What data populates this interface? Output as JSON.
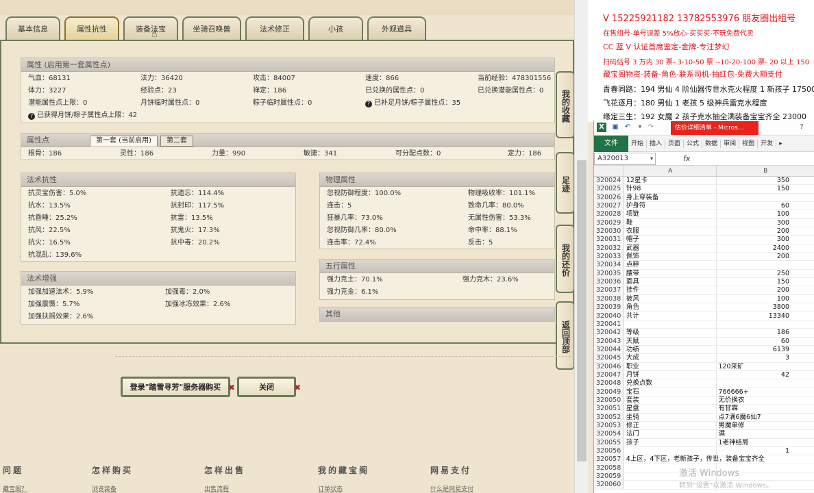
{
  "tabs": [
    {
      "label": "基本信息",
      "active": false
    },
    {
      "label": "属性抗性",
      "active": true
    },
    {
      "label": "装备法宝",
      "active": false
    },
    {
      "label": "坐骑召唤兽",
      "active": false
    },
    {
      "label": "法术修正",
      "active": false
    },
    {
      "label": "小孩",
      "active": false
    },
    {
      "label": "外观道具",
      "active": false
    }
  ],
  "attributes": {
    "header": "属性 (启用第一套属性点)",
    "items": [
      "气血：68131",
      "法力：36420",
      "攻击：84007",
      "速度：866",
      "当前经验：478301556",
      "体力：3227",
      "经验点：23",
      "禅定：186",
      "已兑换的属性点：0",
      "已兑换潜能属性点：0",
      "潜能属性点上限：0",
      "月饼临时属性点：0",
      "粽子临时属性点：0",
      "已补足月饼/粽子属性点：35"
    ],
    "note": "已获得月饼/粽子属性点上限：42"
  },
  "points": {
    "header": "属性点",
    "subtabs": [
      "第一套 (当前启用)",
      "第二套"
    ],
    "items": [
      "根骨：186",
      "灵性：186",
      "力量：990",
      "敏捷：341",
      "可分配点数：0",
      "定力：186"
    ]
  },
  "magic_resist": {
    "header": "法术抗性",
    "items": [
      "抗灵宝伤害：5.0%",
      "抗遗忘：114.4%",
      "抗水：13.5%",
      "抗封印：117.5%",
      "抗昏睡：25.2%",
      "抗雷：13.5%",
      "抗风：22.5%",
      "抗鬼火：17.3%",
      "抗火：16.5%",
      "抗中毒：20.2%",
      "抗混乱：139.6%",
      ""
    ]
  },
  "magic_boost": {
    "header": "法术增强",
    "items": [
      "加强加速法术：5.9%",
      "加强毒：2.0%",
      "加强震慑：5.7%",
      "加强冰冻效果：2.6%",
      "加强扶摇效果：2.6%",
      ""
    ]
  },
  "physical": {
    "header": "物理属性",
    "items": [
      "忽视防御程度：100.0%",
      "物理吸收率：101.1%",
      "连击：5",
      "致命几率：80.0%",
      "狂暴几率：73.0%",
      "无属性伤害：53.3%",
      "忽视防御几率：80.0%",
      "命中率：88.1%",
      "连击率：72.4%",
      "反击：5"
    ]
  },
  "five_elements": {
    "header": "五行属性",
    "items": [
      "强力克土：70.1%",
      "强力克木：23.6%",
      "强力克金：6.1%",
      ""
    ]
  },
  "other": {
    "header": "其他"
  },
  "side_buttons": [
    "我的收藏",
    "足迹",
    "我的还价",
    "返回顶部"
  ],
  "actions": {
    "buy": "登录\"踏雪寻芳\"服务器购买",
    "close": "关闭"
  },
  "footer": [
    {
      "head": "问题",
      "link": "藏宝阁？"
    },
    {
      "head": "怎样购买",
      "link": "浏览装备"
    },
    {
      "head": "怎样出售",
      "link": "出售流程"
    },
    {
      "head": "我的藏宝阁",
      "link": "订单状态"
    },
    {
      "head": "网易支付",
      "link": "什么是网易支付"
    }
  ],
  "ad": {
    "lines": [
      "V 15225921182   13782553976 朋友圈出组号",
      "在售组号-单号误差 5%放心-买买买-不玩免费代卖",
      "CC 蓝 V 认证首席鉴定-金牌-专注梦幻",
      "扫码估号 3 万内 30 票- 3-10-50 票 --10-20-100 票- 20 以上 150",
      "藏宝阁物资-装备-角色-联系司机-抽红包-免费大额支付",
      "青春同路：194 男仙 4 阶仙器传世水克火程度 1 新孩子 17500",
      "飞花逐月：180 男仙 1 老孩 5 级神兵雷克水程度",
      "缘定三生：192 女魔 2 孩子克水抽全满装备宝宝齐全 23000"
    ]
  },
  "excel": {
    "title": "估价详细清单 - Micros...",
    "file_tab": "文件",
    "ribbon_tabs": [
      "开始",
      "插入",
      "页面",
      "公式",
      "数据",
      "审阅",
      "视图",
      "开发"
    ],
    "namebox": "A320013",
    "fx": "fx",
    "col_headers": [
      "",
      "A",
      "B"
    ],
    "rows": [
      [
        "320024",
        "12星卡",
        "350"
      ],
      [
        "320025",
        "针98",
        "150"
      ],
      [
        "320026",
        "身上穿装备",
        ""
      ],
      [
        "320027",
        "护身符",
        "60"
      ],
      [
        "320028",
        "项链",
        "100"
      ],
      [
        "320029",
        "鞋",
        "300"
      ],
      [
        "320030",
        "衣服",
        "200"
      ],
      [
        "320031",
        "帽子",
        "300"
      ],
      [
        "320032",
        "武器",
        "2400"
      ],
      [
        "320033",
        "佩饰",
        "200"
      ],
      [
        "320034",
        "点粹",
        ""
      ],
      [
        "320035",
        "腰带",
        "250"
      ],
      [
        "320036",
        "面具",
        "150"
      ],
      [
        "320037",
        "挂件",
        "200"
      ],
      [
        "320038",
        "披风",
        "100"
      ],
      [
        "320039",
        "角色",
        "3800"
      ],
      [
        "320040",
        "共计",
        "13340"
      ],
      [
        "320041",
        "",
        ""
      ],
      [
        "320042",
        "等级",
        "186"
      ],
      [
        "320043",
        "天赋",
        "60"
      ],
      [
        "320044",
        "功绩",
        "6139"
      ],
      [
        "320045",
        "大成",
        "3"
      ],
      [
        "320046",
        "职业",
        "120采矿"
      ],
      [
        "320047",
        "月饼",
        "42"
      ],
      [
        "320048",
        "兑换点数",
        ""
      ],
      [
        "320049",
        "宝石",
        "766666+"
      ],
      [
        "320050",
        "套装",
        "无价换衣"
      ],
      [
        "320051",
        "星盘",
        "有甘霖"
      ],
      [
        "320052",
        "坐骑",
        "点7满6魔6仙7"
      ],
      [
        "320053",
        "修正",
        "男魔单修"
      ],
      [
        "320054",
        "法门",
        "满"
      ],
      [
        "320055",
        "孩子",
        "1老神结局"
      ],
      [
        "320056",
        "",
        "1"
      ],
      [
        "320057",
        "4上区，4下区，老新孩子，传世，装备宝宝齐全",
        ""
      ],
      [
        "320058",
        "",
        ""
      ],
      [
        "320059",
        "",
        ""
      ],
      [
        "320060",
        "",
        ""
      ]
    ],
    "watermark": "激活 Windows",
    "watermark_sub": "转到\"设置\"以激活 Windows。"
  }
}
